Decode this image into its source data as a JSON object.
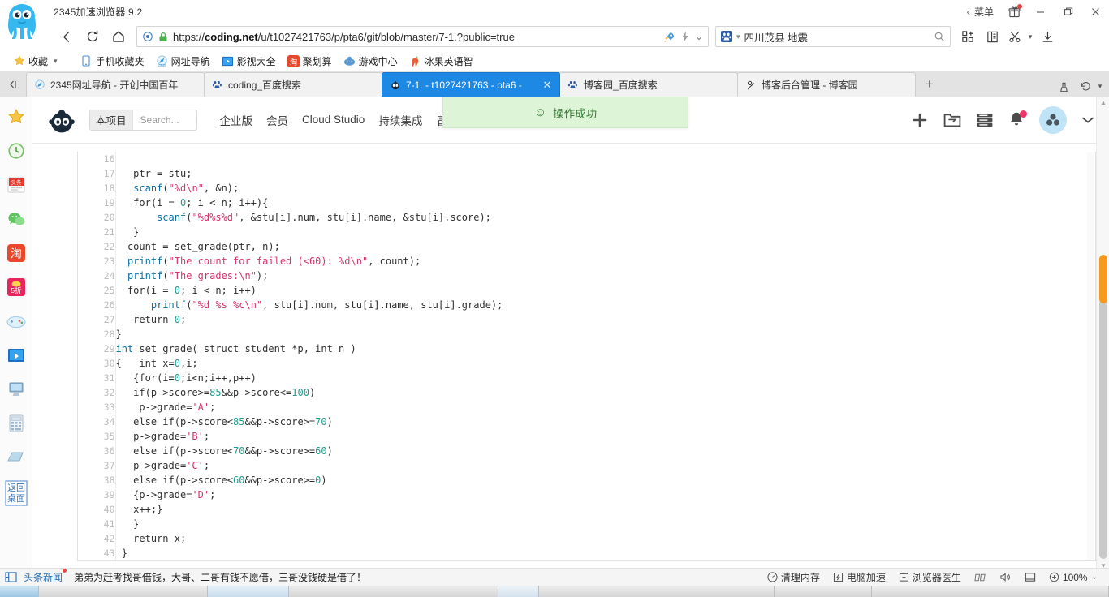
{
  "browser": {
    "app_title": "2345加速浏览器 9.2",
    "titlebar": {
      "menu_label": "菜单",
      "chevron_left": "‹",
      "minimize": "—",
      "maximize": "❐",
      "close": "✕"
    },
    "nav": {
      "back": "back-arrow",
      "reload": "reload-arrow",
      "home": "home-shape",
      "url": "https://coding.net/u/t1027421763/p/pta6/git/blob/master/7-1.?public=true",
      "url_bold": "coding.net",
      "url_prefix": "https://",
      "url_suffix": "/u/t1027421763/p/pta6/git/blob/master/7-1.?public=true",
      "search_value": "四川茂县 地震",
      "search_engine": "baidu-icon",
      "zoom_chevron": "⌄"
    },
    "bookmarks": [
      {
        "label": "收藏",
        "icon": "star-icon",
        "has_caret": true
      },
      {
        "label": "手机收藏夹",
        "icon": "phone-icon"
      },
      {
        "label": "网址导航",
        "icon": "compass-2345-icon"
      },
      {
        "label": "影视大全",
        "icon": "video-icon"
      },
      {
        "label": "聚划算",
        "icon": "taobao-icon"
      },
      {
        "label": "游戏中心",
        "icon": "gamepad-icon"
      },
      {
        "label": "冰果英语智",
        "icon": "apple-icon"
      }
    ],
    "tabs": [
      {
        "title": "2345网址导航 - 开创中国百年",
        "icon": "compass-2345-icon",
        "active": false
      },
      {
        "title": "coding_百度搜索",
        "icon": "baidu-icon",
        "active": false
      },
      {
        "title": "7-1. - t1027421763 - pta6 -",
        "icon": "coding-icon",
        "active": true,
        "close": "✕"
      },
      {
        "title": "博客园_百度搜索",
        "icon": "baidu-icon",
        "active": false
      },
      {
        "title": "博客后台管理 - 博客园",
        "icon": "cnblogs-icon",
        "active": false
      }
    ],
    "new_tab_label": "+"
  },
  "dock": [
    {
      "name": "favorites",
      "icon": "★",
      "label": ""
    },
    {
      "name": "history",
      "icon": "◷",
      "label": ""
    },
    {
      "name": "toutiao",
      "icon": "头条",
      "label": ""
    },
    {
      "name": "wechat",
      "icon": "💬",
      "label": ""
    },
    {
      "name": "taobao",
      "icon": "淘",
      "label": ""
    },
    {
      "name": "discount",
      "icon": "5折",
      "label": ""
    },
    {
      "name": "games",
      "icon": "🎮",
      "label": ""
    },
    {
      "name": "video",
      "icon": "▶",
      "label": ""
    },
    {
      "name": "computer",
      "icon": "🖥",
      "label": ""
    },
    {
      "name": "calculator",
      "icon": "🖩",
      "label": ""
    },
    {
      "name": "inbox",
      "icon": "📥",
      "label": ""
    },
    {
      "name": "show-desktop",
      "icon": "",
      "label": "返回桌面"
    }
  ],
  "site": {
    "logo": "coding-monkey-logo",
    "search_scope": "本项目",
    "search_placeholder": "Search...",
    "nav": [
      {
        "label": "企业版"
      },
      {
        "label": "会员"
      },
      {
        "label": "Cloud Studio"
      },
      {
        "label": "持续集成"
      },
      {
        "label": "冒"
      }
    ],
    "actions": [
      {
        "name": "add-button",
        "icon": "+"
      },
      {
        "name": "projects-button",
        "icon": "folder-arrow-icon"
      },
      {
        "name": "tasks-button",
        "icon": "list-icon"
      },
      {
        "name": "notifications-button",
        "icon": "bell-icon",
        "badge": true
      },
      {
        "name": "user-avatar",
        "icon": "avatar-icon"
      },
      {
        "name": "user-menu-caret",
        "icon": "⌄"
      }
    ],
    "toast": {
      "icon": "☺",
      "message": "操作成功"
    }
  },
  "code": {
    "language": "c",
    "lines": [
      {
        "n": "16",
        "tokens": []
      },
      {
        "n": "17",
        "tokens": [
          {
            "t": "   ptr = stu;",
            "c": "p"
          }
        ]
      },
      {
        "n": "18",
        "tokens": [
          {
            "t": "   ",
            "c": "p"
          },
          {
            "t": "scanf",
            "c": "k"
          },
          {
            "t": "(",
            "c": "p"
          },
          {
            "t": "\"%d\\n\"",
            "c": "s"
          },
          {
            "t": ", &n);",
            "c": "p"
          }
        ]
      },
      {
        "n": "19",
        "tokens": [
          {
            "t": "   for(i = ",
            "c": "p"
          },
          {
            "t": "0",
            "c": "n"
          },
          {
            "t": "; i < n; i++){",
            "c": "p"
          }
        ]
      },
      {
        "n": "20",
        "tokens": [
          {
            "t": "       ",
            "c": "p"
          },
          {
            "t": "scanf",
            "c": "k"
          },
          {
            "t": "(",
            "c": "p"
          },
          {
            "t": "\"%d%s%d\"",
            "c": "s"
          },
          {
            "t": ", &stu[i].num, stu[i].name, &stu[i].score);",
            "c": "p"
          }
        ]
      },
      {
        "n": "21",
        "tokens": [
          {
            "t": "   }",
            "c": "p"
          }
        ]
      },
      {
        "n": "22",
        "tokens": [
          {
            "t": "  count = set_grade(ptr, n);",
            "c": "p"
          }
        ]
      },
      {
        "n": "23",
        "tokens": [
          {
            "t": "  ",
            "c": "p"
          },
          {
            "t": "printf",
            "c": "k"
          },
          {
            "t": "(",
            "c": "p"
          },
          {
            "t": "\"The count for failed (<60): %d\\n\"",
            "c": "s"
          },
          {
            "t": ", count);",
            "c": "p"
          }
        ]
      },
      {
        "n": "24",
        "tokens": [
          {
            "t": "  ",
            "c": "p"
          },
          {
            "t": "printf",
            "c": "k"
          },
          {
            "t": "(",
            "c": "p"
          },
          {
            "t": "\"The grades:\\n\"",
            "c": "s"
          },
          {
            "t": ");",
            "c": "p"
          }
        ]
      },
      {
        "n": "25",
        "tokens": [
          {
            "t": "  for(i = ",
            "c": "p"
          },
          {
            "t": "0",
            "c": "n"
          },
          {
            "t": "; i < n; i++)",
            "c": "p"
          }
        ]
      },
      {
        "n": "26",
        "tokens": [
          {
            "t": "      ",
            "c": "p"
          },
          {
            "t": "printf",
            "c": "k"
          },
          {
            "t": "(",
            "c": "p"
          },
          {
            "t": "\"%d %s %c\\n\"",
            "c": "s"
          },
          {
            "t": ", stu[i].num, stu[i].name, stu[i].grade);",
            "c": "p"
          }
        ]
      },
      {
        "n": "27",
        "tokens": [
          {
            "t": "   return ",
            "c": "p"
          },
          {
            "t": "0",
            "c": "n"
          },
          {
            "t": ";",
            "c": "p"
          }
        ]
      },
      {
        "n": "28",
        "tokens": [
          {
            "t": "}",
            "c": "p"
          }
        ]
      },
      {
        "n": "29",
        "tokens": [
          {
            "t": "int ",
            "c": "k"
          },
          {
            "t": "set_grade( struct student *p, int n )",
            "c": "p"
          }
        ]
      },
      {
        "n": "30",
        "tokens": [
          {
            "t": "{   int x=",
            "c": "p"
          },
          {
            "t": "0",
            "c": "n"
          },
          {
            "t": ",i;",
            "c": "p"
          }
        ]
      },
      {
        "n": "31",
        "tokens": [
          {
            "t": "   {for(i=",
            "c": "p"
          },
          {
            "t": "0",
            "c": "n"
          },
          {
            "t": ";i<n;i++,p++)",
            "c": "p"
          }
        ]
      },
      {
        "n": "32",
        "tokens": [
          {
            "t": "   if(p->score>=",
            "c": "p"
          },
          {
            "t": "85",
            "c": "n"
          },
          {
            "t": "&&p->score<=",
            "c": "p"
          },
          {
            "t": "100",
            "c": "n"
          },
          {
            "t": ")",
            "c": "p"
          }
        ]
      },
      {
        "n": "33",
        "tokens": [
          {
            "t": "    p->grade=",
            "c": "p"
          },
          {
            "t": "'A'",
            "c": "s"
          },
          {
            "t": ";",
            "c": "p"
          }
        ]
      },
      {
        "n": "34",
        "tokens": [
          {
            "t": "   else if(p->score<",
            "c": "p"
          },
          {
            "t": "85",
            "c": "n"
          },
          {
            "t": "&&p->score>=",
            "c": "p"
          },
          {
            "t": "70",
            "c": "n"
          },
          {
            "t": ")",
            "c": "p"
          }
        ]
      },
      {
        "n": "35",
        "tokens": [
          {
            "t": "   p->grade=",
            "c": "p"
          },
          {
            "t": "'B'",
            "c": "s"
          },
          {
            "t": ";",
            "c": "p"
          }
        ]
      },
      {
        "n": "36",
        "tokens": [
          {
            "t": "   else if(p->score<",
            "c": "p"
          },
          {
            "t": "70",
            "c": "n"
          },
          {
            "t": "&&p->score>=",
            "c": "p"
          },
          {
            "t": "60",
            "c": "n"
          },
          {
            "t": ")",
            "c": "p"
          }
        ]
      },
      {
        "n": "37",
        "tokens": [
          {
            "t": "   p->grade=",
            "c": "p"
          },
          {
            "t": "'C'",
            "c": "s"
          },
          {
            "t": ";",
            "c": "p"
          }
        ]
      },
      {
        "n": "38",
        "tokens": [
          {
            "t": "   else if(p->score<",
            "c": "p"
          },
          {
            "t": "60",
            "c": "n"
          },
          {
            "t": "&&p->score>=",
            "c": "p"
          },
          {
            "t": "0",
            "c": "n"
          },
          {
            "t": ")",
            "c": "p"
          }
        ]
      },
      {
        "n": "39",
        "tokens": [
          {
            "t": "   {p->grade=",
            "c": "p"
          },
          {
            "t": "'D'",
            "c": "s"
          },
          {
            "t": ";",
            "c": "p"
          }
        ]
      },
      {
        "n": "40",
        "tokens": [
          {
            "t": "   x++;}",
            "c": "p"
          }
        ]
      },
      {
        "n": "41",
        "tokens": [
          {
            "t": "   }",
            "c": "p"
          }
        ]
      },
      {
        "n": "42",
        "tokens": [
          {
            "t": "   return x;",
            "c": "p"
          }
        ]
      },
      {
        "n": "43",
        "tokens": [
          {
            "t": " }",
            "c": "p"
          }
        ]
      }
    ]
  },
  "status": {
    "news_label": "头条新闻",
    "news_text": "弟弟为赶考找哥借钱，大哥、二哥有钱不愿借，三哥没钱硬是借了！",
    "tools": [
      {
        "label": "清理内存",
        "icon": "gauge-icon"
      },
      {
        "label": "电脑加速",
        "icon": "bolt-icon"
      },
      {
        "label": "浏览器医生",
        "icon": "plus-box-icon"
      }
    ],
    "icons": [
      {
        "name": "screenshot-icon",
        "glyph": "▱"
      },
      {
        "name": "sound-icon",
        "glyph": "🔊"
      },
      {
        "name": "window-icon",
        "glyph": "▭"
      }
    ],
    "zoom": "100%",
    "zoom_caret": "⌄"
  },
  "colors": {
    "accent": "#1e88e5",
    "toast_bg": "#ddf5d6",
    "toast_text": "#3b7a3b",
    "scrollbar": "#f59a1e",
    "string": "#d6336c",
    "keyword": "#0b6fa4",
    "number": "#1f9d8f"
  }
}
